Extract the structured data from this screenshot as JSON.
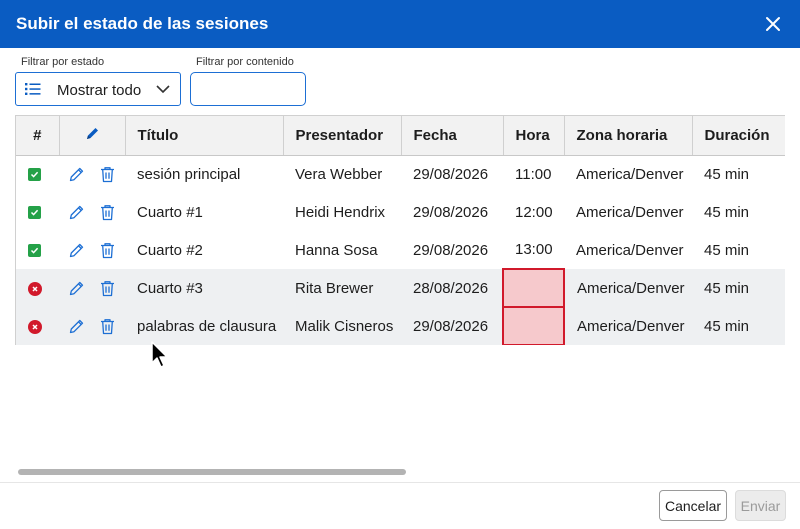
{
  "dialog": {
    "title": "Subir el estado de las sesiones"
  },
  "filters": {
    "status_label": "Filtrar por estado",
    "status_value": "Mostrar todo",
    "content_label": "Filtrar por contenido",
    "content_value": ""
  },
  "table": {
    "headers": {
      "num": "#",
      "title": "Título",
      "presenter": "Presentador",
      "date": "Fecha",
      "time": "Hora",
      "tz": "Zona horaria",
      "duration": "Duración"
    },
    "rows": [
      {
        "status": "ok",
        "title": "sesión principal",
        "presenter": "Vera Webber",
        "date": "29/08/2026",
        "time": "11:00",
        "tz": "America/Denver",
        "duration": "45 min"
      },
      {
        "status": "ok",
        "title": "Cuarto #1",
        "presenter": "Heidi Hendrix",
        "date": "29/08/2026",
        "time": "12:00",
        "tz": "America/Denver",
        "duration": "45 min"
      },
      {
        "status": "ok",
        "title": "Cuarto #2",
        "presenter": "Hanna Sosa",
        "date": "29/08/2026",
        "time": "13:00",
        "tz": "America/Denver",
        "duration": "45 min"
      },
      {
        "status": "error",
        "title": "Cuarto #3",
        "presenter": "Rita Brewer",
        "date": "28/08/2026",
        "time": "",
        "tz": "America/Denver",
        "duration": "45 min"
      },
      {
        "status": "error",
        "title": "palabras de clausura",
        "presenter": "Malik Cisneros",
        "date": "29/08/2026",
        "time": "",
        "tz": "America/Denver",
        "duration": "45 min"
      }
    ]
  },
  "footer": {
    "cancel_label": "Cancelar",
    "send_label": "Enviar"
  },
  "colors": {
    "header": "#0a5cc2",
    "ok": "#24a148",
    "error": "#d1192b",
    "error_cell": "#f6c9cc"
  },
  "icons": {
    "close": "close-icon",
    "list": "list-icon",
    "chevron": "chevron-down-icon",
    "edit": "pencil-icon",
    "delete": "trash-icon",
    "ok": "check-icon",
    "error": "error-x-icon"
  }
}
